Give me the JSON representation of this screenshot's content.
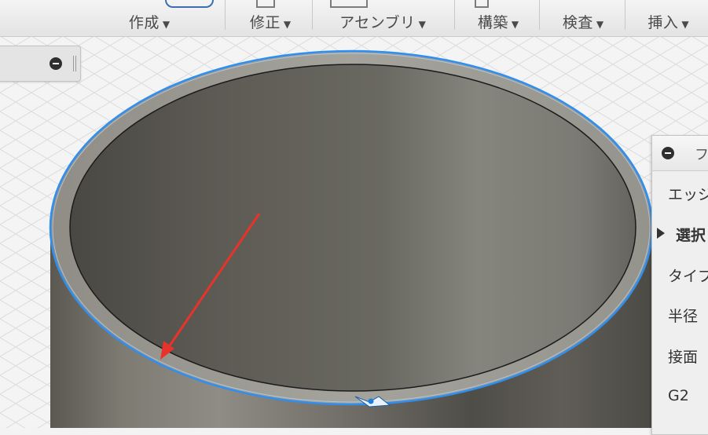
{
  "toolbar": {
    "groups": [
      {
        "label": "作成",
        "caret": "▼"
      },
      {
        "label": "修正",
        "caret": "▼"
      },
      {
        "label": "アセンブリ",
        "caret": "▼"
      },
      {
        "label": "構築",
        "caret": "▼"
      },
      {
        "label": "検査",
        "caret": "▼"
      },
      {
        "label": "挿入",
        "caret": "▼"
      }
    ]
  },
  "fillet_panel": {
    "title": "フ",
    "rows": {
      "edge": "エッジ",
      "selection": "選択",
      "type": "タイプ",
      "radius": "半径",
      "tangent": "接面",
      "g2": "G2"
    }
  },
  "colors": {
    "selection_edge": "#2f8ff0",
    "annotation_arrow": "#e8332a",
    "body": "#75746c",
    "panel_bg": "#efefef"
  }
}
